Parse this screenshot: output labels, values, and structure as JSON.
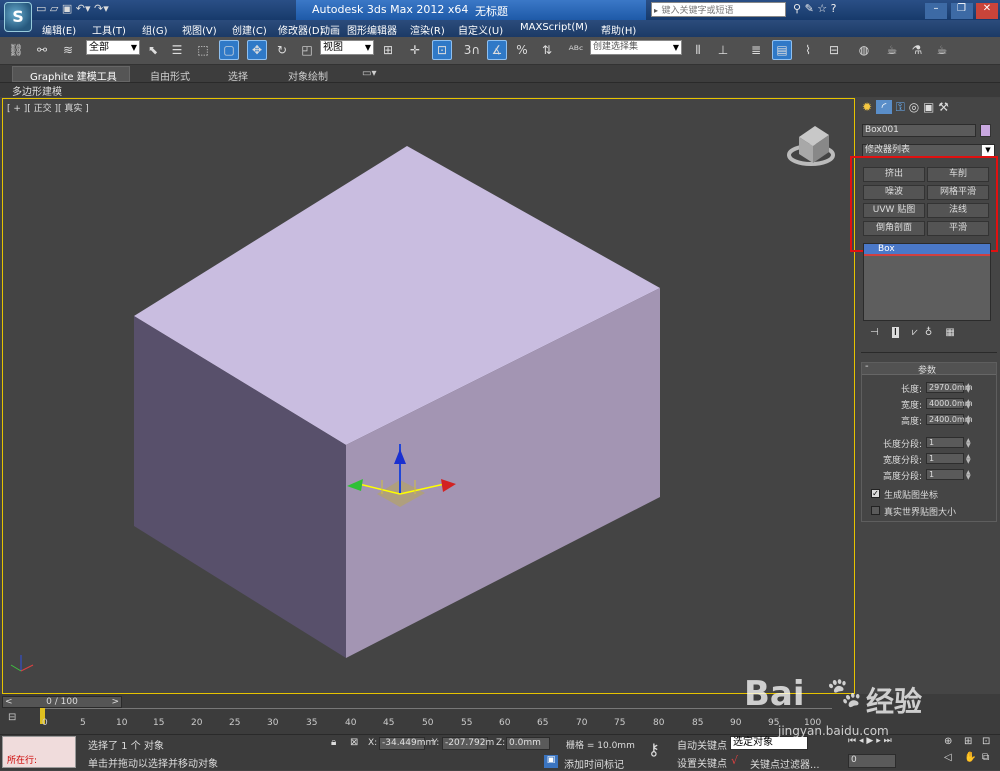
{
  "titlebar": {
    "app_title": "Autodesk 3ds Max  2012 x64",
    "doc_title": "无标题",
    "search_placeholder": "键入关键字或短语"
  },
  "menu": [
    "编辑(E)",
    "工具(T)",
    "组(G)",
    "视图(V)",
    "创建(C)",
    "修改器(D)",
    "动画",
    "图形编辑器",
    "渲染(R)",
    "自定义(U)",
    "MAXScript(M)",
    "帮助(H)"
  ],
  "toolbar": {
    "filter_value": "全部",
    "coord_value": "视图",
    "selection_set_placeholder": "创建选择集"
  },
  "ribbon": {
    "tabs": [
      "Graphite 建模工具",
      "自由形式",
      "选择",
      "对象绘制"
    ],
    "sub_label": "多边形建模"
  },
  "viewport": {
    "label": "[ + ][ 正交 ][ 真实 ]",
    "box_top_color": "#c9bde0",
    "box_left_color": "#58506b",
    "box_right_color": "#a395b3"
  },
  "cmd": {
    "object_name": "Box001",
    "object_color": "#c9a8e0",
    "modifier_list": "修改器列表",
    "modifier_buttons": [
      "挤出",
      "车削",
      "噪波",
      "网格平滑",
      "UVW 贴图",
      "法线",
      "倒角剖面",
      "平滑"
    ],
    "stack_item": "Box",
    "rollout_title": "参数",
    "params": [
      {
        "label": "长度:",
        "value": "2970.0mm"
      },
      {
        "label": "宽度:",
        "value": "4000.0mm"
      },
      {
        "label": "高度:",
        "value": "2400.0mm"
      }
    ],
    "segments": [
      {
        "label": "长度分段:",
        "value": "1"
      },
      {
        "label": "宽度分段:",
        "value": "1"
      },
      {
        "label": "高度分段:",
        "value": "1"
      }
    ],
    "checks": [
      {
        "label": "生成贴图坐标",
        "checked": true
      },
      {
        "label": "真实世界贴图大小",
        "checked": false
      }
    ]
  },
  "timeline": {
    "frame_display": "0 / 100",
    "ticks": [
      "0",
      "5",
      "10",
      "15",
      "20",
      "25",
      "30",
      "35",
      "40",
      "45",
      "50",
      "55",
      "60",
      "65",
      "70",
      "75",
      "80",
      "85",
      "90",
      "95",
      "100"
    ]
  },
  "status": {
    "script_label": "所在行:",
    "selection_text": "选择了 1 个 对象",
    "hint_text": "单击并拖动以选择并移动对象",
    "x_label": "X:",
    "x_value": "-34.449mm",
    "y_label": "Y:",
    "y_value": "-207.792m",
    "z_label": "Z:",
    "z_value": "0.0mm",
    "grid_text": "栅格 = 10.0mm",
    "add_time_tag": "添加时间标记",
    "auto_key": "自动关键点",
    "set_key": "设置关键点",
    "selected_value": "选定对象",
    "key_filters": "关键点过滤器...",
    "frame_value": "0"
  },
  "watermark": {
    "brand": "Bai",
    "brand_suffix": "经验",
    "url": "jingyan.baidu.com"
  }
}
